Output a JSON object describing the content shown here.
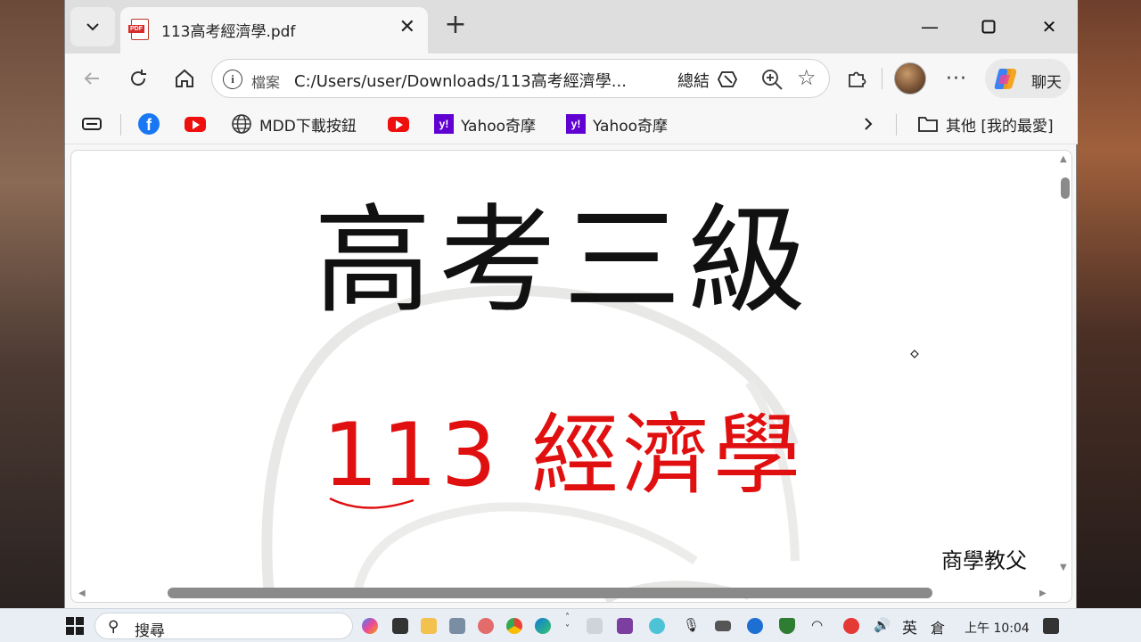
{
  "browser": {
    "tab": {
      "title": "113高考經濟學.pdf",
      "favicon_text": "PDF"
    },
    "toolbar": {
      "scheme_label": "檔案",
      "url": "C:/Users/user/Downloads/113高考經濟學...",
      "summary_label": "總結",
      "copilot_label": "聊天"
    },
    "bookmarks": [
      {
        "label": "MDD下載按鈕"
      },
      {
        "label": "Yahoo奇摩"
      },
      {
        "label": "Yahoo奇摩"
      }
    ],
    "other_favorites": "其他 [我的最愛]"
  },
  "document": {
    "title": "高考三級",
    "subtitle": "113 經濟學",
    "author": "商學教父"
  },
  "taskbar": {
    "search_label": "搜尋",
    "ime": "英",
    "ime2": "倉",
    "time": "上午 10:04"
  },
  "colors": {
    "subtitle": "#e01010",
    "accent": "#0067c0"
  }
}
